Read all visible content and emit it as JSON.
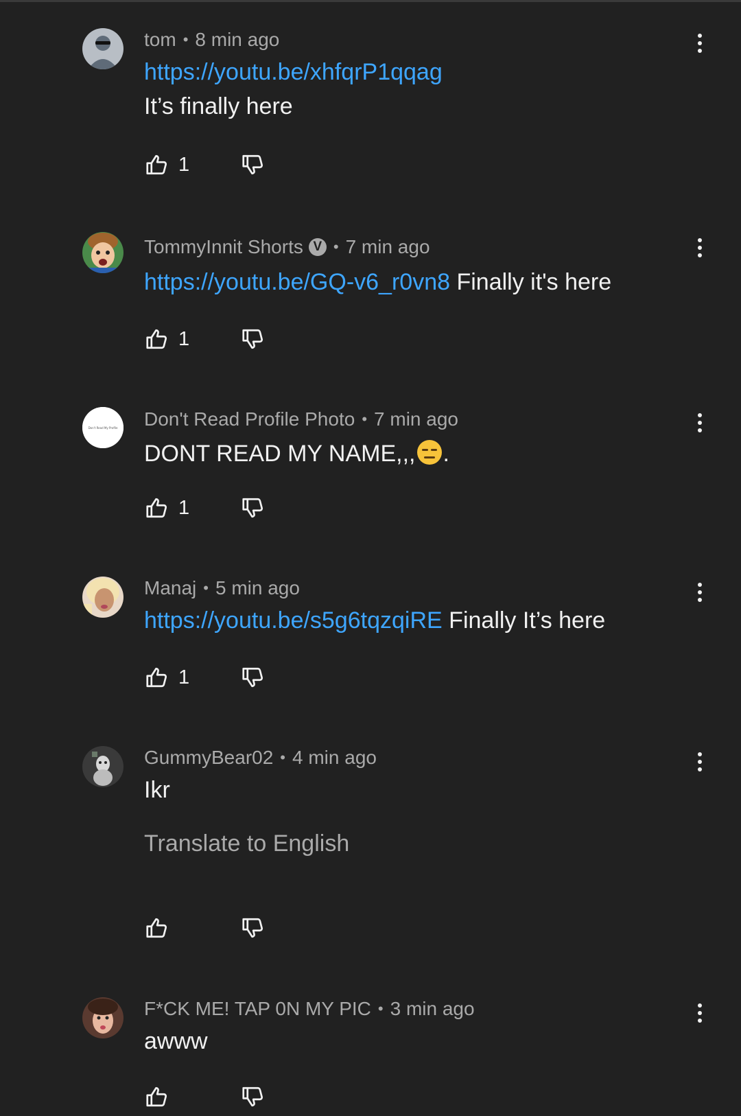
{
  "comments": [
    {
      "author": "tom",
      "time": "8 min ago",
      "link": "https://youtu.be/xhfqrP1qqag",
      "text": "It’s finally here",
      "likes": "1"
    },
    {
      "author": "TommyInnit Shorts",
      "verified_mark": "V",
      "time": "7 min ago",
      "link": "https://youtu.be/GQ-v6_r0vn8",
      "text": "Finally it's here",
      "likes": "1"
    },
    {
      "author": "Don't Read Profile Photo",
      "time": "7 min ago",
      "text": "DONT READ MY NAME,,,",
      "text_suffix": ".",
      "likes": "1",
      "avatar_text": "Don't Read My Profile"
    },
    {
      "author": "Manaj",
      "time": "5 min ago",
      "link": "https://youtu.be/s5g6tqzqiRE",
      "text": "Finally It’s here",
      "likes": "1"
    },
    {
      "author": "GummyBear02",
      "time": "4 min ago",
      "text": "Ikr",
      "translate": "Translate to English"
    },
    {
      "author": "F*CK ME! TAP 0N MY PIC",
      "time": "3 min ago",
      "text": "awww"
    }
  ],
  "separator": "•",
  "colors": {
    "background": "#212121",
    "link": "#3ea6ff",
    "secondary_text": "#aaaaaa",
    "primary_text": "#f1f1f1"
  }
}
